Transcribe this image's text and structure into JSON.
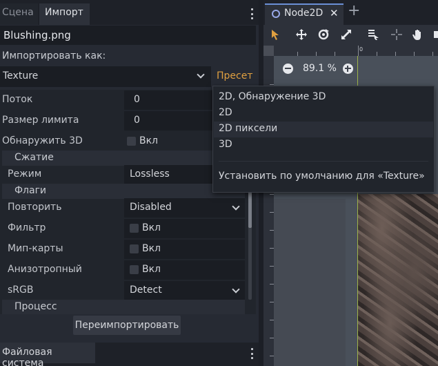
{
  "left_dock": {
    "tabs": [
      {
        "label": "Сцена",
        "active": false
      },
      {
        "label": "Импорт",
        "active": true
      }
    ],
    "file_name": "Blushing.png",
    "import_as_label": "Импортировать как:",
    "importer": "Texture",
    "preset_label": "Пресет",
    "properties": {
      "flow": {
        "label": "Поток",
        "value": "0"
      },
      "size_limit": {
        "label": "Размер лимита",
        "value": "0"
      },
      "detect_3d": {
        "label": "Обнаружить 3D",
        "value": "Вкл"
      },
      "compress_section": "Сжатие",
      "mode": {
        "label": "Режим",
        "value": "Lossless"
      },
      "flags_section": "Флаги",
      "repeat": {
        "label": "Повторить",
        "value": "Disabled"
      },
      "filter": {
        "label": "Фильтр",
        "value": "Вкл"
      },
      "mipmaps": {
        "label": "Мип-карты",
        "value": "Вкл"
      },
      "anisotropic": {
        "label": "Анизотропный",
        "value": "Вкл"
      },
      "srgb": {
        "label": "sRGB",
        "value": "Detect"
      },
      "process_section": "Процесс"
    },
    "reimport_label": "Переимпортировать"
  },
  "bottom_dock": {
    "tab_label": "Файловая система"
  },
  "editor": {
    "scene_tab": "Node2D",
    "close_glyph": "✕",
    "add_glyph": "+",
    "zoom": "89.1 %",
    "ruler_zero": "0",
    "toolbar_icons": [
      "select-arrow-icon",
      "move-icon",
      "rotate-icon",
      "scale-icon",
      "list-select-icon",
      "pivot-icon",
      "pan-hand-icon",
      "ruler-icon"
    ],
    "accent_color": "#e0a040",
    "axis_color": "#9fb54a"
  },
  "preset_menu": {
    "items": [
      "2D, Обнаружение 3D",
      "2D",
      "2D пиксели",
      "3D"
    ],
    "hovered_index": 2,
    "default_item": "Установить по умолчанию для «Texture»"
  }
}
